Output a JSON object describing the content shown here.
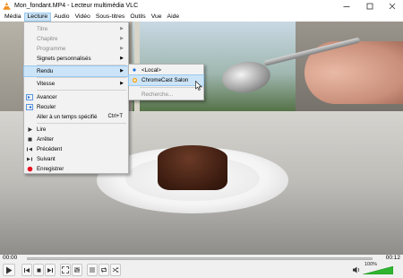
{
  "window": {
    "title": "Mon_fondant.MP4 - Lecteur multimédia VLC"
  },
  "menubar": [
    "Média",
    "Lecture",
    "Audio",
    "Vidéo",
    "Sous-titres",
    "Outils",
    "Vue",
    "Aide"
  ],
  "lecture_menu": {
    "items": [
      {
        "label": "Titre",
        "enabled": false,
        "submenu": true
      },
      {
        "label": "Chapitre",
        "enabled": false,
        "submenu": true
      },
      {
        "label": "Programme",
        "enabled": false,
        "submenu": true
      },
      {
        "label": "Signets personnalisés",
        "enabled": true,
        "submenu": true
      },
      {
        "label": "Rendu",
        "enabled": true,
        "submenu": true,
        "highlighted": true
      },
      {
        "label": "Vitesse",
        "enabled": true,
        "submenu": true
      },
      {
        "label": "Avancer",
        "enabled": true,
        "icon": "forward-icon"
      },
      {
        "label": "Reculer",
        "enabled": true,
        "icon": "backward-icon"
      },
      {
        "label": "Aller à un temps spécifié",
        "enabled": true,
        "shortcut": "Ctrl+T"
      },
      {
        "label": "Lire",
        "enabled": true,
        "icon": "play-icon"
      },
      {
        "label": "Arrêter",
        "enabled": true,
        "icon": "stop-icon"
      },
      {
        "label": "Précédent",
        "enabled": true,
        "icon": "previous-icon"
      },
      {
        "label": "Suivant",
        "enabled": true,
        "icon": "next-icon"
      },
      {
        "label": "Enregistrer",
        "enabled": true,
        "icon": "record-icon"
      }
    ]
  },
  "rendu_submenu": {
    "items": [
      {
        "label": "<Local>",
        "selected": true
      },
      {
        "label": "ChromeCast Salon",
        "highlighted": true
      },
      {
        "label": "Recherche...",
        "enabled": false
      }
    ]
  },
  "player": {
    "time_elapsed": "00:00",
    "time_total": "00:12",
    "volume": "100%"
  },
  "colors": {
    "menu_highlight": "#cce4f7",
    "record_red": "#e81123",
    "accent_blue": "#1e6fd9",
    "volume_green": "#2fb52f"
  }
}
